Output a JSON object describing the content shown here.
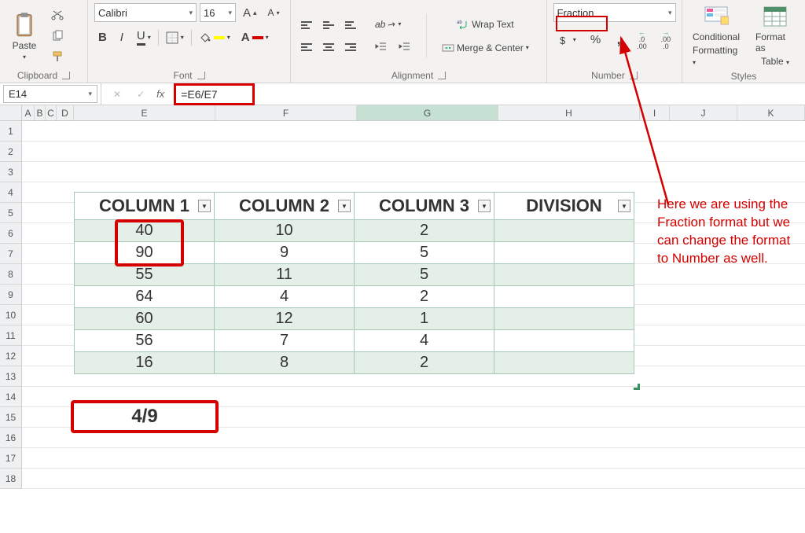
{
  "ribbon": {
    "clipboard": {
      "paste_label": "Paste",
      "group": "Clipboard"
    },
    "font": {
      "family": "Calibri",
      "size": "16",
      "bold": "B",
      "italic": "I",
      "underline": "U",
      "inc": "A",
      "dec": "A",
      "group": "Font"
    },
    "alignment": {
      "wrap": "Wrap Text",
      "merge": "Merge & Center",
      "group": "Alignment"
    },
    "number": {
      "format": "Fraction",
      "group": "Number",
      "inc_dec_1": ".0",
      "inc_dec_1b": ".00",
      "inc_dec_2": ".00",
      "inc_dec_2b": ".0"
    },
    "styles": {
      "cond": "Conditional",
      "cond2": "Formatting",
      "fmt": "Format as",
      "fmt2": "Table",
      "group": "Styles"
    }
  },
  "formula_bar": {
    "name_box": "E14",
    "fx": "fx",
    "formula": "=E6/E7"
  },
  "column_labels": {
    "A": "A",
    "B": "B",
    "C": "C",
    "D": "D",
    "E": "E",
    "F": "F",
    "G": "G",
    "H": "H",
    "I": "I",
    "J": "J",
    "K": "K"
  },
  "table": {
    "headers": {
      "c1": "COLUMN 1",
      "c2": "COLUMN 2",
      "c3": "COLUMN 3",
      "c4": "DIVISION"
    },
    "rows": [
      {
        "c1": "40",
        "c2": "10",
        "c3": "2",
        "c4": ""
      },
      {
        "c1": "90",
        "c2": "9",
        "c3": "5",
        "c4": ""
      },
      {
        "c1": "55",
        "c2": "11",
        "c3": "5",
        "c4": ""
      },
      {
        "c1": "64",
        "c2": "4",
        "c3": "2",
        "c4": ""
      },
      {
        "c1": "60",
        "c2": "12",
        "c3": "1",
        "c4": ""
      },
      {
        "c1": "56",
        "c2": "7",
        "c3": "4",
        "c4": ""
      },
      {
        "c1": "16",
        "c2": "8",
        "c3": "2",
        "c4": ""
      }
    ]
  },
  "result_cell": "4/9",
  "annotation": "Here we are using the Fraction format but we can change the format to Number as well."
}
